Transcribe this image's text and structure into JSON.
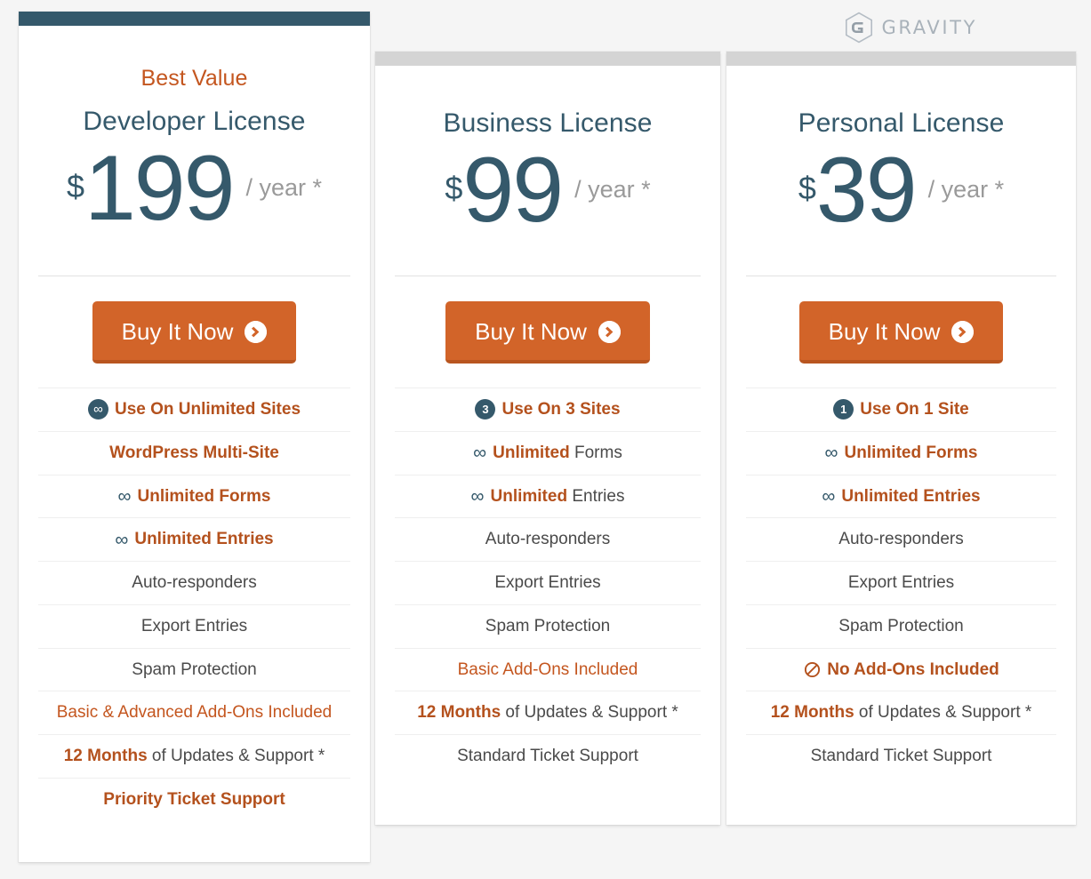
{
  "brand": {
    "name": "GRAVITY",
    "logo_icon": "gravity-hexagon-g-icon",
    "logo_color": "#a9b2ba"
  },
  "colors": {
    "accent_orange": "#c4561f",
    "button_orange": "#d26429",
    "button_orange_shadow": "#b8551f",
    "slate": "#35596b",
    "page_background": "#f5f5f5",
    "card_background": "#ffffff",
    "divider": "#e2e2e2",
    "row_separator": "#efefef",
    "highlight_text": "#b4511d",
    "muted_text": "#9a9a9a",
    "body_text": "#4a4a4a"
  },
  "buy_button": {
    "label": "Buy It Now",
    "icon": "chevron-right-circle-icon"
  },
  "plans": [
    {
      "id": "developer",
      "badge": "Best Value",
      "has_badge": true,
      "title": "Developer License",
      "currency": "$",
      "price": "199",
      "period": "/ year *",
      "topbar_color": "#35596b",
      "features": [
        {
          "icon": "infinity-badge-icon",
          "icon_type": "count-badge-infinity",
          "badge_text": "∞",
          "style": "all-accent-bold",
          "text": "Use On Unlimited Sites"
        },
        {
          "icon": null,
          "icon_type": "none",
          "style": "all-accent-bold",
          "text": "WordPress Multi-Site"
        },
        {
          "icon": "infinity-icon",
          "icon_type": "infinity-glyph",
          "style": "all-accent-bold",
          "text": "Unlimited Forms"
        },
        {
          "icon": "infinity-icon",
          "icon_type": "infinity-glyph",
          "style": "all-accent-bold",
          "text": "Unlimited Entries"
        },
        {
          "icon": null,
          "icon_type": "none",
          "style": "plain",
          "text": "Auto-responders"
        },
        {
          "icon": null,
          "icon_type": "none",
          "style": "plain",
          "text": "Export Entries"
        },
        {
          "icon": null,
          "icon_type": "none",
          "style": "plain",
          "text": "Spam Protection"
        },
        {
          "icon": null,
          "icon_type": "none",
          "style": "all-accent",
          "text": "Basic & Advanced Add-Ons Included"
        },
        {
          "icon": null,
          "icon_type": "none",
          "style": "split",
          "bold_prefix": "12 Months",
          "text": " of Updates & Support *"
        },
        {
          "icon": null,
          "icon_type": "none",
          "style": "all-accent-bold",
          "text": "Priority Ticket Support"
        }
      ]
    },
    {
      "id": "business",
      "badge": "",
      "has_badge": false,
      "title": "Business License",
      "currency": "$",
      "price": "99",
      "period": "/ year *",
      "topbar_color": "#d4d4d4",
      "features": [
        {
          "icon": "count-3-badge-icon",
          "icon_type": "count-badge",
          "badge_text": "3",
          "style": "all-accent-bold",
          "text": "Use On 3 Sites"
        },
        {
          "icon": "infinity-icon",
          "icon_type": "infinity-glyph",
          "style": "split",
          "bold_prefix": "Unlimited",
          "text": " Forms"
        },
        {
          "icon": "infinity-icon",
          "icon_type": "infinity-glyph",
          "style": "split",
          "bold_prefix": "Unlimited",
          "text": " Entries"
        },
        {
          "icon": null,
          "icon_type": "none",
          "style": "plain",
          "text": "Auto-responders"
        },
        {
          "icon": null,
          "icon_type": "none",
          "style": "plain",
          "text": "Export Entries"
        },
        {
          "icon": null,
          "icon_type": "none",
          "style": "plain",
          "text": "Spam Protection"
        },
        {
          "icon": null,
          "icon_type": "none",
          "style": "all-accent",
          "text": "Basic Add-Ons Included"
        },
        {
          "icon": null,
          "icon_type": "none",
          "style": "split",
          "bold_prefix": "12 Months",
          "text": " of Updates & Support *"
        },
        {
          "icon": null,
          "icon_type": "none",
          "style": "plain",
          "text": "Standard Ticket Support"
        }
      ]
    },
    {
      "id": "personal",
      "badge": "",
      "has_badge": false,
      "title": "Personal License",
      "currency": "$",
      "price": "39",
      "period": "/ year *",
      "topbar_color": "#d4d4d4",
      "features": [
        {
          "icon": "count-1-badge-icon",
          "icon_type": "count-badge",
          "badge_text": "1",
          "style": "all-accent-bold",
          "text": "Use On 1 Site"
        },
        {
          "icon": "infinity-icon",
          "icon_type": "infinity-glyph",
          "style": "all-accent-bold",
          "text": "Unlimited Forms"
        },
        {
          "icon": "infinity-icon",
          "icon_type": "infinity-glyph",
          "style": "all-accent-bold",
          "text": "Unlimited Entries"
        },
        {
          "icon": null,
          "icon_type": "none",
          "style": "plain",
          "text": "Auto-responders"
        },
        {
          "icon": null,
          "icon_type": "none",
          "style": "plain",
          "text": "Export Entries"
        },
        {
          "icon": null,
          "icon_type": "none",
          "style": "plain",
          "text": "Spam Protection"
        },
        {
          "icon": "no-entry-icon",
          "icon_type": "prohibition",
          "style": "all-accent-bold",
          "text": "No Add-Ons Included"
        },
        {
          "icon": null,
          "icon_type": "none",
          "style": "split",
          "bold_prefix": "12 Months",
          "text": " of Updates & Support *"
        },
        {
          "icon": null,
          "icon_type": "none",
          "style": "plain",
          "text": "Standard Ticket Support"
        }
      ]
    }
  ]
}
